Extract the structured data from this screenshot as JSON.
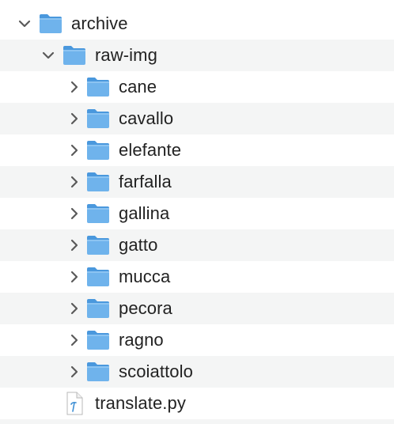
{
  "tree": {
    "root": {
      "label": "archive",
      "expanded": true,
      "icon": "folder-icon"
    },
    "child": {
      "label": "raw-img",
      "expanded": true,
      "icon": "folder-icon"
    },
    "folders": [
      {
        "label": "cane"
      },
      {
        "label": "cavallo"
      },
      {
        "label": "elefante"
      },
      {
        "label": "farfalla"
      },
      {
        "label": "gallina"
      },
      {
        "label": "gatto"
      },
      {
        "label": "mucca"
      },
      {
        "label": "pecora"
      },
      {
        "label": "ragno"
      },
      {
        "label": "scoiattolo"
      }
    ],
    "file": {
      "label": "translate.py",
      "icon": "python-file-icon"
    }
  },
  "colors": {
    "folder_body": "#6fb3ec",
    "folder_tab": "#4a98dd",
    "chevron": "#5a5a5a",
    "stripe": "#f4f5f5"
  }
}
